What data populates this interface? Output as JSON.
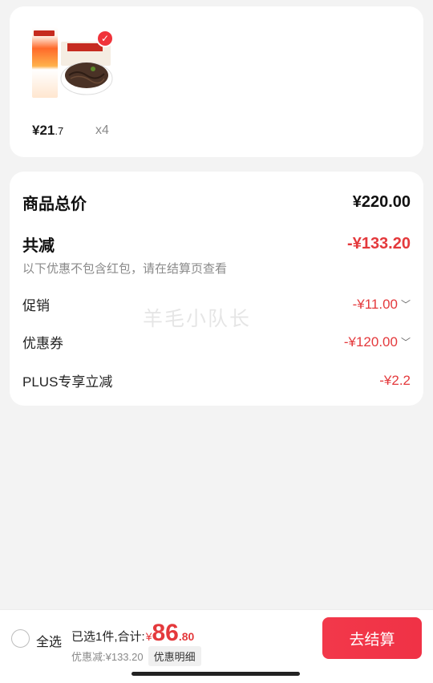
{
  "product": {
    "price_int": "¥21",
    "price_dec": ".7",
    "quantity": "x4",
    "image_icon": "product-image-icon",
    "selected_icon": "check-badge-icon"
  },
  "summary": {
    "total_label": "商品总价",
    "total_value": "¥220.00",
    "reduce_label": "共减",
    "reduce_value": "-¥133.20",
    "hint": "以下优惠不包含红包，请在结算页查看",
    "promo_label": "促销",
    "promo_value": "-¥11.00",
    "coupon_label": "优惠券",
    "coupon_value": "-¥120.00",
    "plus_label": "PLUS专享立减",
    "plus_value": "-¥2.2"
  },
  "watermark": "羊毛小队长",
  "bottom": {
    "select_all": "全选",
    "selected_text": "已选1件,合计:",
    "currency": "¥",
    "amount_int": "86",
    "amount_dec": ".80",
    "discount_text": "优惠减:¥133.20",
    "detail_label": "优惠明细",
    "checkout_label": "去结算"
  },
  "colors": {
    "accent_red": "#e4393c",
    "button_red": "#f03246",
    "background": "#f3f3f3"
  }
}
